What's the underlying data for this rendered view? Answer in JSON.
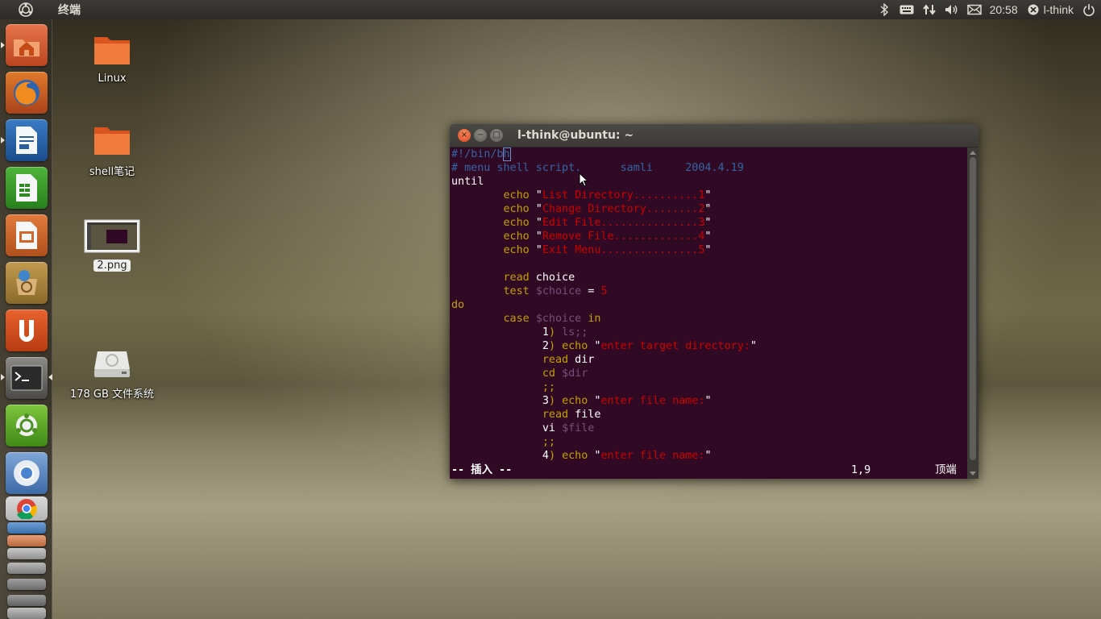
{
  "top_panel": {
    "app_title": "终端",
    "time": "20:58",
    "user": "l-think",
    "icons": [
      "ubuntu-logo-icon",
      "bluetooth-icon",
      "keyboard-icon",
      "network-icon",
      "volume-icon",
      "mail-icon",
      "user-status-icon",
      "power-icon"
    ]
  },
  "launcher": {
    "items": [
      "home-folder-icon",
      "firefox-icon",
      "writer-icon",
      "calc-icon",
      "impress-icon",
      "software-center-icon",
      "ubuntu-one-icon",
      "terminal-icon",
      "app-icon",
      "chromium-icon",
      "chrome-icon"
    ]
  },
  "desktop": {
    "icons": [
      {
        "label": "Linux"
      },
      {
        "label": "shell笔记"
      },
      {
        "label": "2.png"
      },
      {
        "label": "178 GB 文件系统"
      }
    ]
  },
  "terminal": {
    "title": "l-think@ubuntu: ~",
    "close_glyph": "×",
    "min_glyph": "−",
    "max_glyph": "□",
    "lines": [
      [
        {
          "t": "#!/bin/b",
          "c": "com"
        },
        {
          "t": "h",
          "c": "com",
          "cursor": true
        }
      ],
      [
        {
          "t": "# menu shell script.      samli     2004.4.19",
          "c": "com"
        }
      ],
      [
        {
          "t": "until",
          "c": "plain"
        }
      ],
      [
        {
          "t": "        ",
          "c": "plain"
        },
        {
          "t": "echo",
          "c": "kw"
        },
        {
          "t": " \"",
          "c": "plain"
        },
        {
          "t": "List Directory..........1",
          "c": "str"
        },
        {
          "t": "\"",
          "c": "plain"
        }
      ],
      [
        {
          "t": "        ",
          "c": "plain"
        },
        {
          "t": "echo",
          "c": "kw"
        },
        {
          "t": " \"",
          "c": "plain"
        },
        {
          "t": "Change Directory........2",
          "c": "str"
        },
        {
          "t": "\"",
          "c": "plain"
        }
      ],
      [
        {
          "t": "        ",
          "c": "plain"
        },
        {
          "t": "echo",
          "c": "kw"
        },
        {
          "t": " \"",
          "c": "plain"
        },
        {
          "t": "Edit File...............3",
          "c": "str"
        },
        {
          "t": "\"",
          "c": "plain"
        }
      ],
      [
        {
          "t": "        ",
          "c": "plain"
        },
        {
          "t": "echo",
          "c": "kw"
        },
        {
          "t": " \"",
          "c": "plain"
        },
        {
          "t": "Remove File.............4",
          "c": "str"
        },
        {
          "t": "\"",
          "c": "plain"
        }
      ],
      [
        {
          "t": "        ",
          "c": "plain"
        },
        {
          "t": "echo",
          "c": "kw"
        },
        {
          "t": " \"",
          "c": "plain"
        },
        {
          "t": "Exit Menu...............5",
          "c": "str"
        },
        {
          "t": "\"",
          "c": "plain"
        }
      ],
      [
        {
          "t": "",
          "c": "plain"
        }
      ],
      [
        {
          "t": "        ",
          "c": "plain"
        },
        {
          "t": "read",
          "c": "kw"
        },
        {
          "t": " choice",
          "c": "plain"
        }
      ],
      [
        {
          "t": "        ",
          "c": "plain"
        },
        {
          "t": "test",
          "c": "kw"
        },
        {
          "t": " ",
          "c": "plain"
        },
        {
          "t": "$choice",
          "c": "var"
        },
        {
          "t": " = ",
          "c": "plain"
        },
        {
          "t": "5",
          "c": "str"
        }
      ],
      [
        {
          "t": "do",
          "c": "kw"
        }
      ],
      [
        {
          "t": "        ",
          "c": "plain"
        },
        {
          "t": "case",
          "c": "kw"
        },
        {
          "t": " ",
          "c": "plain"
        },
        {
          "t": "$choice",
          "c": "var"
        },
        {
          "t": " ",
          "c": "plain"
        },
        {
          "t": "in",
          "c": "kw"
        }
      ],
      [
        {
          "t": "              1",
          "c": "plain"
        },
        {
          "t": ")",
          "c": "kw"
        },
        {
          "t": " ",
          "c": "plain"
        },
        {
          "t": "ls;;",
          "c": "var"
        }
      ],
      [
        {
          "t": "              2",
          "c": "plain"
        },
        {
          "t": ")",
          "c": "kw"
        },
        {
          "t": " ",
          "c": "plain"
        },
        {
          "t": "echo",
          "c": "kw"
        },
        {
          "t": " \"",
          "c": "plain"
        },
        {
          "t": "enter target directory:",
          "c": "str"
        },
        {
          "t": "\"",
          "c": "plain"
        }
      ],
      [
        {
          "t": "              ",
          "c": "plain"
        },
        {
          "t": "read",
          "c": "kw"
        },
        {
          "t": " dir",
          "c": "plain"
        }
      ],
      [
        {
          "t": "              ",
          "c": "plain"
        },
        {
          "t": "cd",
          "c": "kw"
        },
        {
          "t": " ",
          "c": "plain"
        },
        {
          "t": "$dir",
          "c": "var"
        }
      ],
      [
        {
          "t": "              ",
          "c": "plain"
        },
        {
          "t": ";;",
          "c": "kw"
        }
      ],
      [
        {
          "t": "              3",
          "c": "plain"
        },
        {
          "t": ")",
          "c": "kw"
        },
        {
          "t": " ",
          "c": "plain"
        },
        {
          "t": "echo",
          "c": "kw"
        },
        {
          "t": " \"",
          "c": "plain"
        },
        {
          "t": "enter file name:",
          "c": "str"
        },
        {
          "t": "\"",
          "c": "plain"
        }
      ],
      [
        {
          "t": "              ",
          "c": "plain"
        },
        {
          "t": "read",
          "c": "kw"
        },
        {
          "t": " file",
          "c": "plain"
        }
      ],
      [
        {
          "t": "              ",
          "c": "plain"
        },
        {
          "t": "vi",
          "c": "plain"
        },
        {
          "t": " ",
          "c": "plain"
        },
        {
          "t": "$file",
          "c": "var"
        }
      ],
      [
        {
          "t": "              ",
          "c": "plain"
        },
        {
          "t": ";;",
          "c": "kw"
        }
      ],
      [
        {
          "t": "              4",
          "c": "plain"
        },
        {
          "t": ")",
          "c": "kw"
        },
        {
          "t": " ",
          "c": "plain"
        },
        {
          "t": "echo",
          "c": "kw"
        },
        {
          "t": " \"",
          "c": "plain"
        },
        {
          "t": "enter file name:",
          "c": "str"
        },
        {
          "t": "\"",
          "c": "plain"
        }
      ]
    ],
    "status": {
      "mode": "-- 插入 --",
      "position": "1,9",
      "scroll": "顶端"
    }
  },
  "colors": {
    "terminal_bg": "#300a24",
    "comment": "#3465a4",
    "keyword": "#c4a000",
    "string": "#cc0000",
    "variable": "#75507b"
  }
}
